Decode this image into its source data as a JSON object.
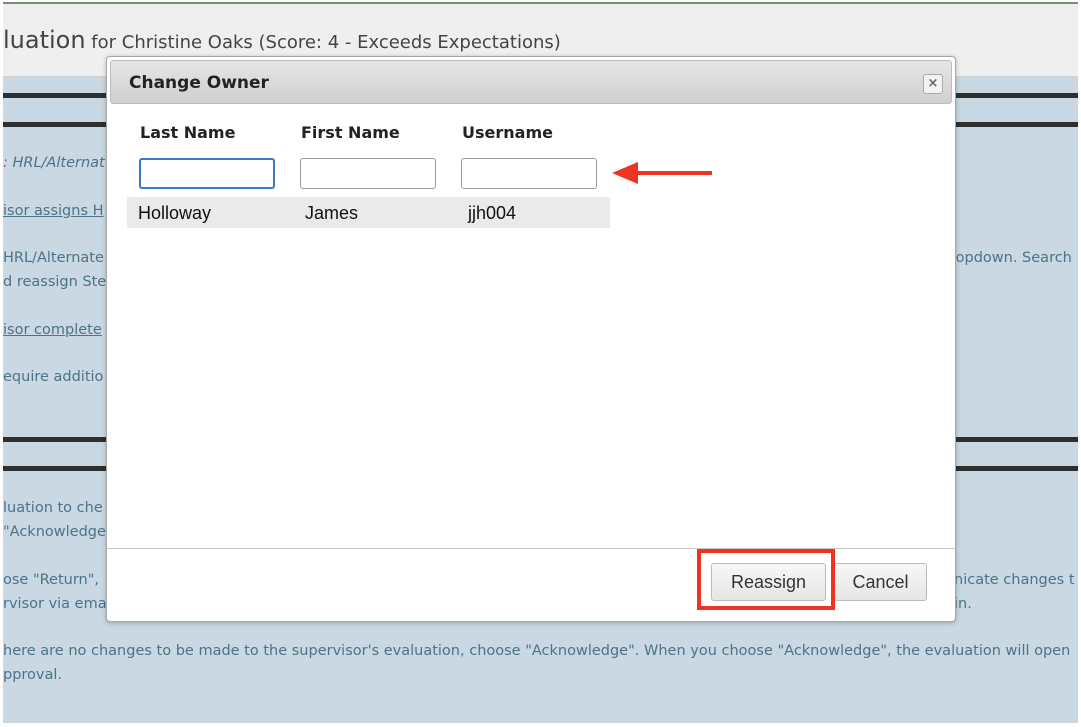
{
  "page": {
    "title_main": "luation",
    "title_sub": " for Christine Oaks (Score: 4 - Exceeds Expectations)",
    "background_lines": [
      ": HRL/Alternat",
      "isor assigns H",
      "HRL/Alternate",
      "ropdown. Search",
      "d reassign Step",
      "isor complete",
      "equire additio",
      "luation to che",
      " \"Acknowledge",
      "ose \"Return\",",
      "nicate changes t",
      "rvisor via ema",
      "in.",
      "here are no changes to be made to the supervisor's evaluation, choose \"Acknowledge\". When you choose \"Acknowledge\", the evaluation will open",
      "pproval."
    ]
  },
  "dialog": {
    "title": "Change Owner",
    "close_symbol": "×",
    "columns": [
      "Last Name",
      "First Name",
      "Username"
    ],
    "inputs": [
      {
        "value": "",
        "placeholder": ""
      },
      {
        "value": "",
        "placeholder": ""
      },
      {
        "value": "",
        "placeholder": ""
      }
    ],
    "results": [
      {
        "last_name": "Holloway",
        "first_name": "James",
        "username": "jjh004"
      }
    ],
    "buttons": {
      "reassign": "Reassign",
      "cancel": "Cancel"
    }
  },
  "annotations": {
    "arrow_icon": "left-arrow-icon",
    "highlight_color": "#ee3322"
  }
}
